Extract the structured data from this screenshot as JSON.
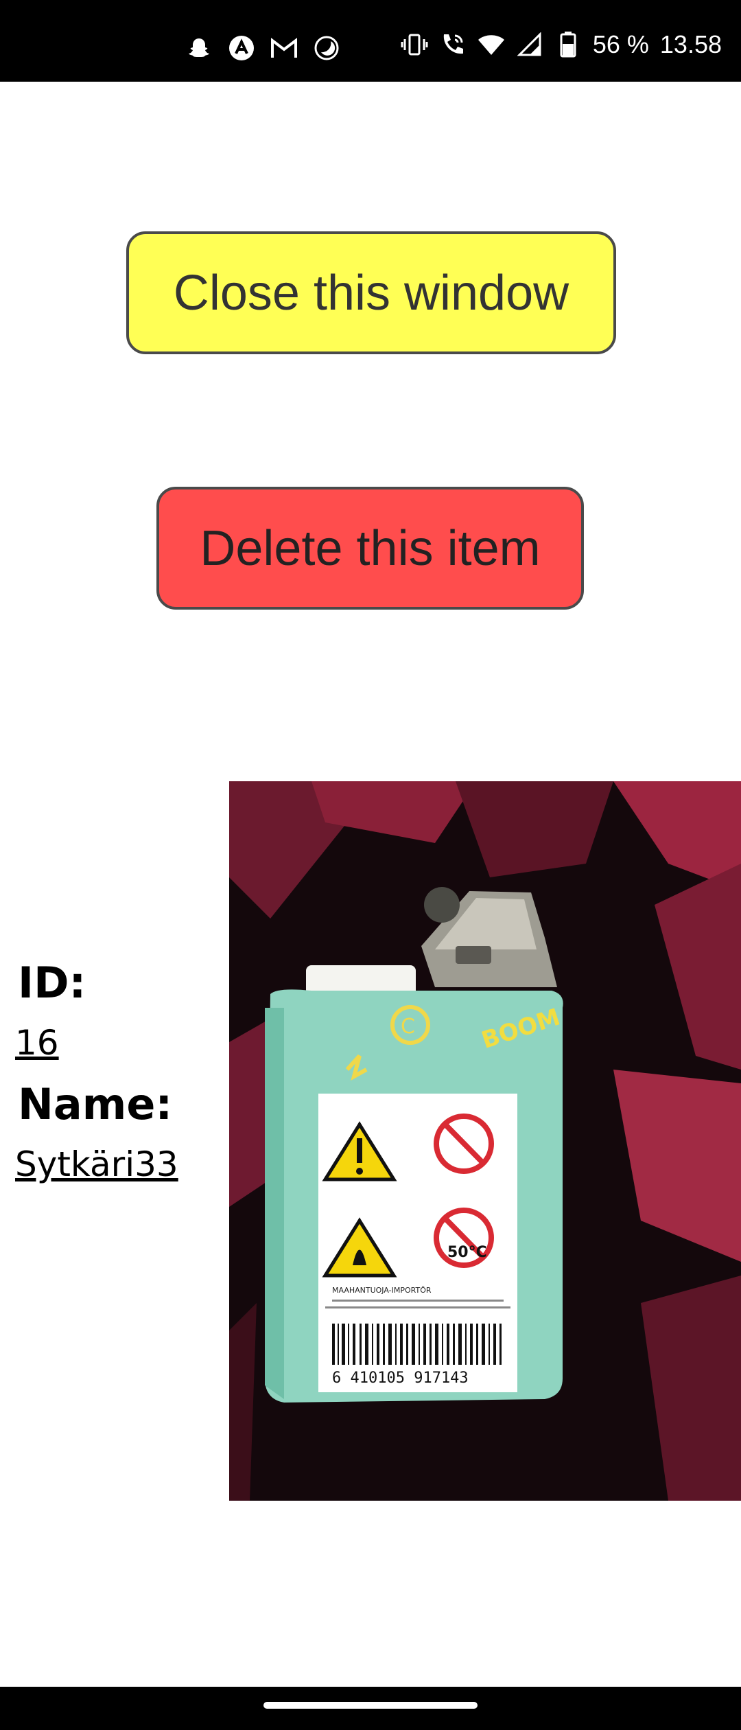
{
  "status_bar": {
    "icons_left": [
      "snapchat-icon",
      "app-a-icon",
      "gmail-icon",
      "moon-icon"
    ],
    "icons_right": [
      "vibrate-icon",
      "wifi-call-icon",
      "wifi-icon",
      "signal-icon",
      "battery-icon"
    ],
    "battery": "56 %",
    "time": "13.58"
  },
  "buttons": {
    "close_label": "Close this window",
    "delete_label": "Delete this item"
  },
  "colors": {
    "close_button": "#ffff55",
    "delete_button": "#ff4d4d"
  },
  "item": {
    "id_label": "ID:",
    "id_value": "16",
    "name_label": "Name:",
    "name_value": "Sytkäri33"
  },
  "photo": {
    "subject": "lighter-photo",
    "barcode_text": "6 410105 917143",
    "importer_text": "MAAHANTUOJA-IMPORTÖR",
    "temp_warning": "50°C"
  }
}
